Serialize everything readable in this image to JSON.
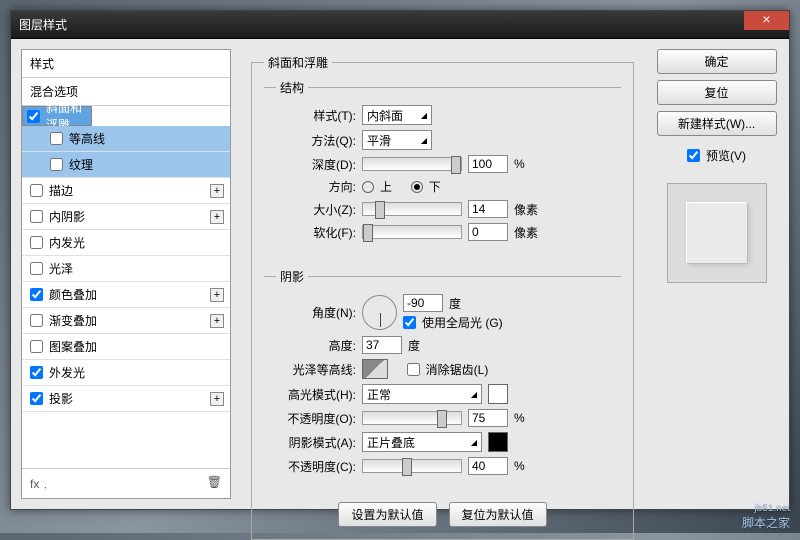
{
  "title": "图层样式",
  "sidebar": {
    "styles": "样式",
    "blend": "混合选项",
    "items": [
      {
        "l": "斜面和浮雕",
        "c": true,
        "sel": true,
        "plus": false
      },
      {
        "l": "等高线",
        "c": false,
        "sub": true,
        "sel2": true
      },
      {
        "l": "纹理",
        "c": false,
        "sub": true,
        "sel2": true
      },
      {
        "l": "描边",
        "c": false,
        "plus": true
      },
      {
        "l": "内阴影",
        "c": false,
        "plus": true
      },
      {
        "l": "内发光",
        "c": false
      },
      {
        "l": "光泽",
        "c": false
      },
      {
        "l": "颜色叠加",
        "c": true,
        "plus": true
      },
      {
        "l": "渐变叠加",
        "c": false,
        "plus": true
      },
      {
        "l": "图案叠加",
        "c": false
      },
      {
        "l": "外发光",
        "c": true
      },
      {
        "l": "投影",
        "c": true,
        "plus": true
      }
    ]
  },
  "bevel": {
    "title": "斜面和浮雕",
    "struct": "结构",
    "styleL": "样式(T):",
    "styleV": "内斜面",
    "methodL": "方法(Q):",
    "methodV": "平滑",
    "depthL": "深度(D):",
    "depthV": "100",
    "depthU": "%",
    "dirL": "方向:",
    "up": "上",
    "down": "下",
    "sizeL": "大小(Z):",
    "sizeV": "14",
    "sizeU": "像素",
    "softL": "软化(F):",
    "softV": "0",
    "softU": "像素"
  },
  "shade": {
    "title": "阴影",
    "angleL": "角度(N):",
    "angleV": "-90",
    "deg": "度",
    "globalL": "使用全局光 (G)",
    "altL": "高度:",
    "altV": "37",
    "glossL": "光泽等高线:",
    "aaL": "消除锯齿(L)",
    "hlModeL": "高光模式(H):",
    "hlModeV": "正常",
    "hlOpL": "不透明度(O):",
    "hlOpV": "75",
    "pct": "%",
    "shModeL": "阴影模式(A):",
    "shModeV": "正片叠底",
    "shOpL": "不透明度(C):",
    "shOpV": "40"
  },
  "btns": {
    "def": "设置为默认值",
    "reset": "复位为默认值"
  },
  "right": {
    "ok": "确定",
    "cancel": "复位",
    "new": "新建样式(W)...",
    "preview": "预览(V)"
  },
  "wm": {
    "site": "jb51.net",
    "name": "脚本之家"
  }
}
